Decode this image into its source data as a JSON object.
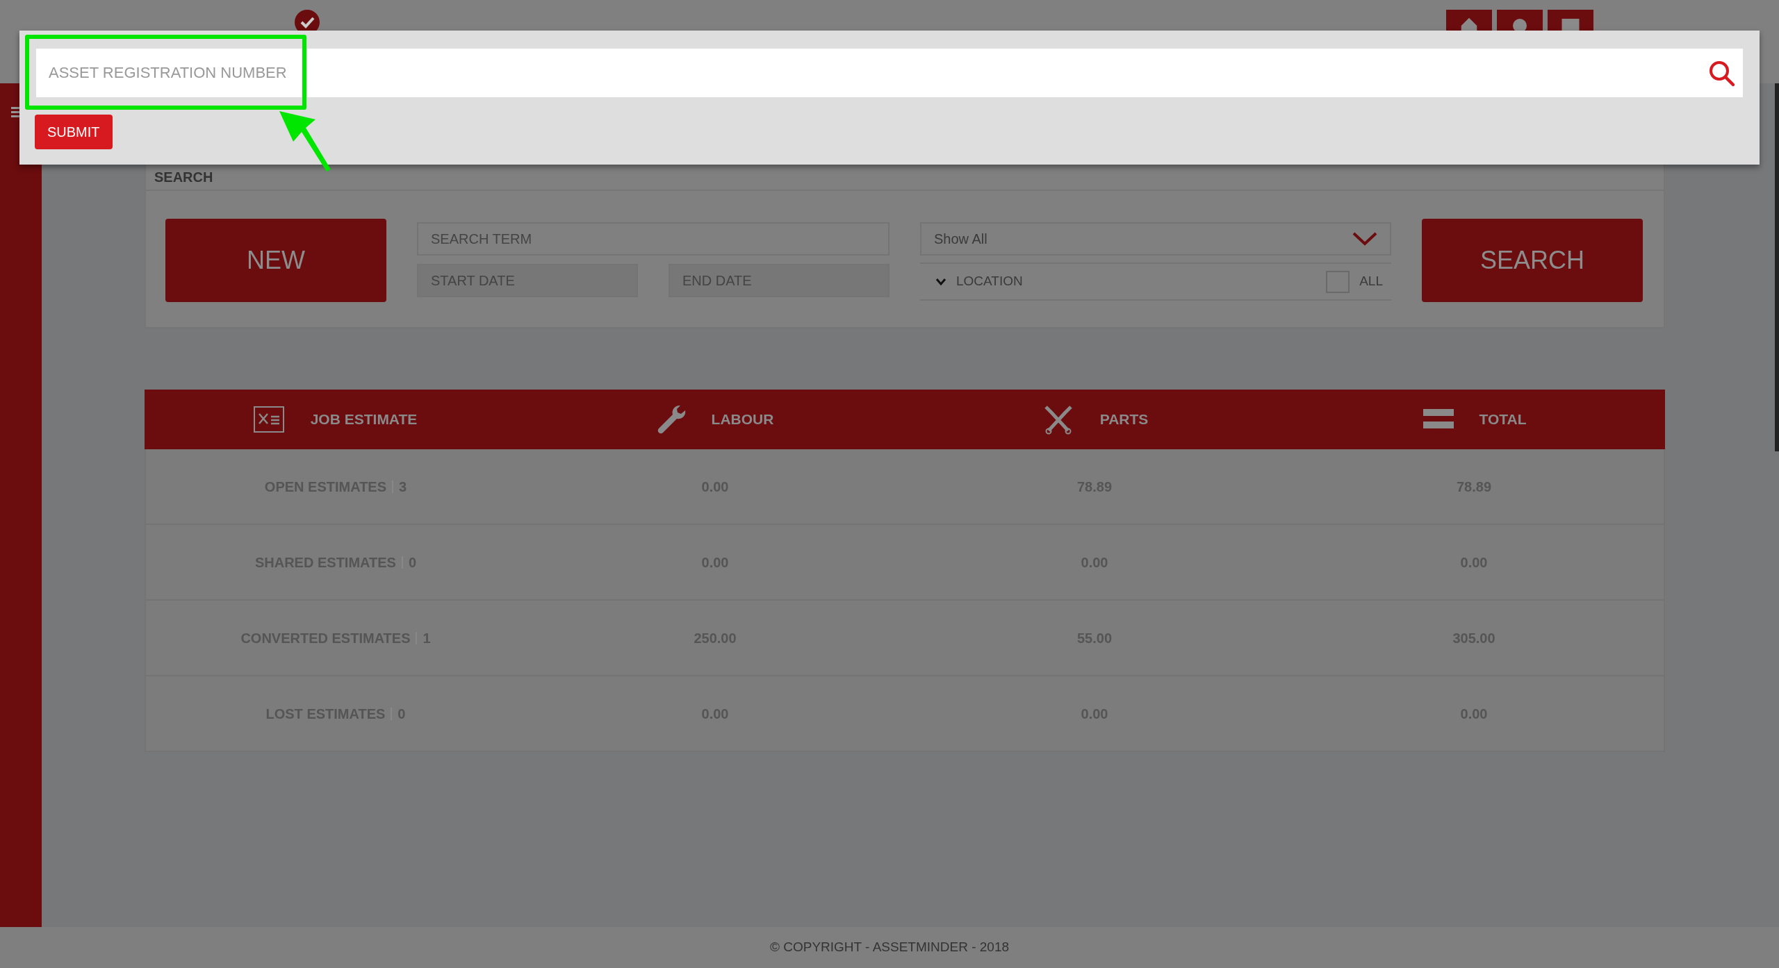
{
  "modal": {
    "field": {
      "placeholder": "ASSET REGISTRATION NUMBER",
      "highlighted": true
    },
    "submit": "SUBMIT"
  },
  "search_panel": {
    "title": "SEARCH",
    "new_button": "NEW",
    "search_term": {
      "placeholder": "SEARCH TERM"
    },
    "start_date": {
      "placeholder": "START DATE"
    },
    "end_date": {
      "placeholder": "END DATE"
    },
    "filter": {
      "value": "Show All"
    },
    "location": {
      "label": "LOCATION",
      "all_label": "ALL",
      "all_checked": false
    },
    "search_button": "SEARCH"
  },
  "table": {
    "columns": [
      {
        "label": "JOB ESTIMATE",
        "kind": "estimate"
      },
      {
        "label": "LABOUR",
        "kind": "wrench"
      },
      {
        "label": "PARTS",
        "kind": "pistons"
      },
      {
        "label": "TOTAL",
        "kind": "equals"
      }
    ],
    "rows": [
      {
        "label": "OPEN ESTIMATES",
        "count": "3",
        "labour": "0.00",
        "parts": "78.89",
        "total": "78.89"
      },
      {
        "label": "SHARED ESTIMATES",
        "count": "0",
        "labour": "0.00",
        "parts": "0.00",
        "total": "0.00"
      },
      {
        "label": "CONVERTED ESTIMATES",
        "count": "1",
        "labour": "250.00",
        "parts": "55.00",
        "total": "305.00"
      },
      {
        "label": "LOST ESTIMATES",
        "count": "0",
        "labour": "0.00",
        "parts": "0.00",
        "total": "0.00"
      }
    ]
  },
  "footer": "© COPYRIGHT - ASSETMINDER - 2018"
}
